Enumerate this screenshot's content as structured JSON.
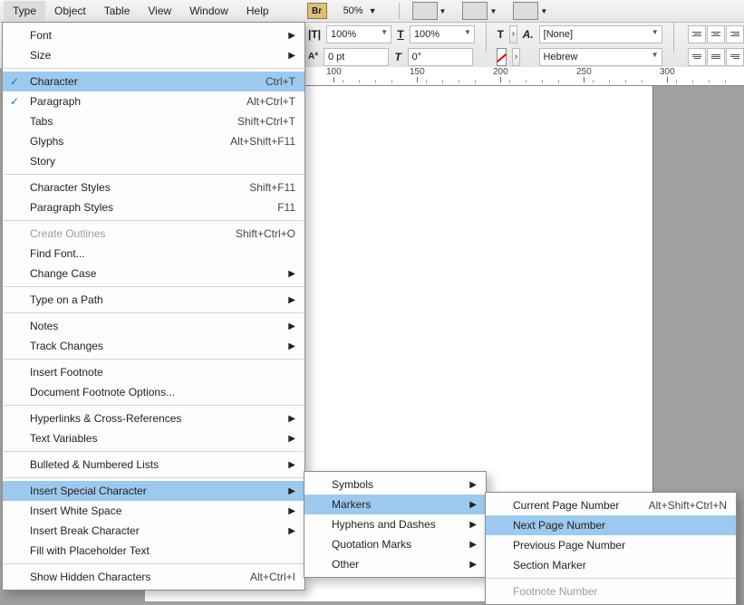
{
  "menubar": {
    "items": [
      "Type",
      "Object",
      "Table",
      "View",
      "Window",
      "Help"
    ],
    "bridge_badge": "Br",
    "zoom": "50%"
  },
  "controls": {
    "scaleH": "100%",
    "scaleV": "100%",
    "baseline": "0 pt",
    "skew": "0°",
    "charStyle": "[None]",
    "language": "Hebrew"
  },
  "ruler": {
    "ticks": [
      100,
      150,
      200,
      250,
      300
    ]
  },
  "type_menu": [
    {
      "label": "Font",
      "submenu": true
    },
    {
      "label": "Size",
      "submenu": true
    },
    {
      "sep": true
    },
    {
      "label": "Character",
      "shortcut": "Ctrl+T",
      "checked": true,
      "hl": true
    },
    {
      "label": "Paragraph",
      "shortcut": "Alt+Ctrl+T",
      "checked": true
    },
    {
      "label": "Tabs",
      "shortcut": "Shift+Ctrl+T"
    },
    {
      "label": "Glyphs",
      "shortcut": "Alt+Shift+F11"
    },
    {
      "label": "Story"
    },
    {
      "sep": true
    },
    {
      "label": "Character Styles",
      "shortcut": "Shift+F11"
    },
    {
      "label": "Paragraph Styles",
      "shortcut": "F11"
    },
    {
      "sep": true
    },
    {
      "label": "Create Outlines",
      "shortcut": "Shift+Ctrl+O",
      "disabled": true
    },
    {
      "label": "Find Font..."
    },
    {
      "label": "Change Case",
      "submenu": true
    },
    {
      "sep": true
    },
    {
      "label": "Type on a Path",
      "submenu": true
    },
    {
      "sep": true
    },
    {
      "label": "Notes",
      "submenu": true
    },
    {
      "label": "Track Changes",
      "submenu": true
    },
    {
      "sep": true
    },
    {
      "label": "Insert Footnote"
    },
    {
      "label": "Document Footnote Options..."
    },
    {
      "sep": true
    },
    {
      "label": "Hyperlinks & Cross-References",
      "submenu": true
    },
    {
      "label": "Text Variables",
      "submenu": true
    },
    {
      "sep": true
    },
    {
      "label": "Bulleted & Numbered Lists",
      "submenu": true
    },
    {
      "sep": true
    },
    {
      "label": "Insert Special Character",
      "submenu": true,
      "hl": true
    },
    {
      "label": "Insert White Space",
      "submenu": true
    },
    {
      "label": "Insert Break Character",
      "submenu": true
    },
    {
      "label": "Fill with Placeholder Text"
    },
    {
      "sep": true
    },
    {
      "label": "Show Hidden Characters",
      "shortcut": "Alt+Ctrl+I"
    }
  ],
  "special_char_menu": [
    {
      "label": "Symbols",
      "submenu": true
    },
    {
      "label": "Markers",
      "submenu": true,
      "hl": true
    },
    {
      "label": "Hyphens and Dashes",
      "submenu": true
    },
    {
      "label": "Quotation Marks",
      "submenu": true
    },
    {
      "label": "Other",
      "submenu": true
    }
  ],
  "markers_menu": [
    {
      "label": "Current Page Number",
      "shortcut": "Alt+Shift+Ctrl+N"
    },
    {
      "label": "Next Page Number",
      "hl": true
    },
    {
      "label": "Previous Page Number"
    },
    {
      "label": "Section Marker"
    },
    {
      "sep": true
    },
    {
      "label": "Footnote Number",
      "disabled": true
    }
  ]
}
